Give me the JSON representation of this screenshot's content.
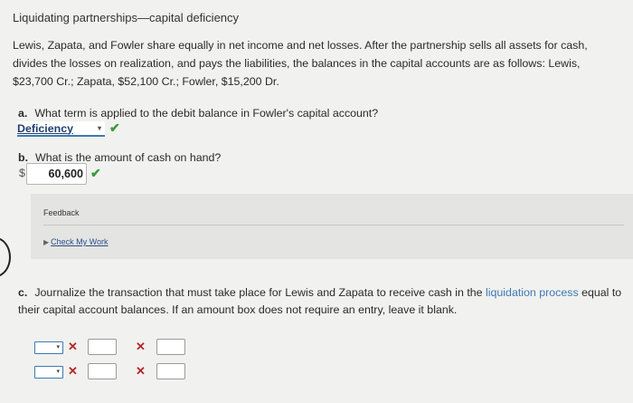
{
  "title": "Liquidating partnerships—capital deficiency",
  "intro": "Lewis, Zapata, and Fowler share equally in net income and net losses. After the partnership sells all assets for cash, divides the losses on realization, and pays the liabilities, the balances in the capital accounts are as follows: Lewis, $23,700 Cr.; Zapata, $52,100 Cr.; Fowler, $15,200 Dr.",
  "question_a": {
    "letter": "a.",
    "text": "What term is applied to the debit balance in Fowler's capital account?",
    "answer": "Deficiency",
    "status": "correct"
  },
  "question_b": {
    "letter": "b.",
    "text": "What is the amount of cash on hand?",
    "currency": "$",
    "answer": "60,600",
    "status": "correct"
  },
  "feedback": {
    "label": "Feedback",
    "check_work": "Check My Work"
  },
  "question_c": {
    "letter": "c.",
    "text_before": "Journalize the transaction that must take place for Lewis and Zapata to receive cash in the ",
    "link": "liquidation process",
    "text_after": " equal to their capital account balances. If an amount box does not require an entry, leave it blank.",
    "rows": [
      {
        "account": "",
        "debit": "",
        "credit": "",
        "status": "incorrect"
      },
      {
        "account": "",
        "debit": "",
        "credit": "",
        "status": "incorrect"
      }
    ]
  },
  "icons": {
    "check": "✔",
    "x": "✕",
    "caret": "▾",
    "triangle": "▶"
  },
  "colors": {
    "correct": "#3a9a3a",
    "incorrect": "#b3272a",
    "link": "#3c7ab5"
  }
}
